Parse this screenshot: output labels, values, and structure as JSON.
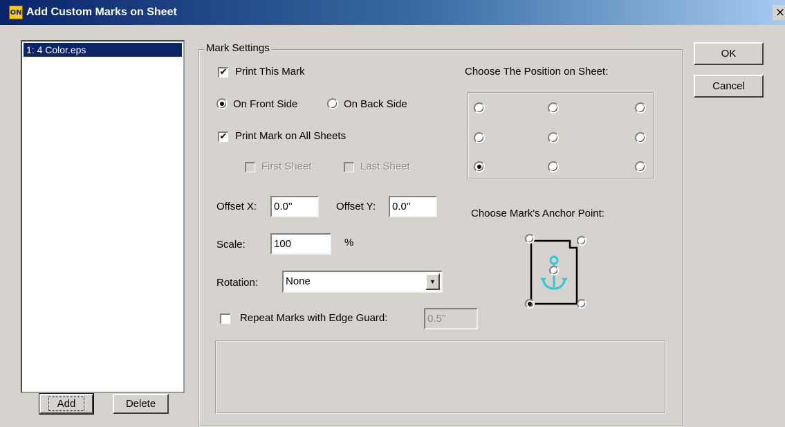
{
  "window": {
    "title": "Add Custom Marks on Sheet",
    "icon_label": "ON",
    "close_label": "×"
  },
  "marks_list": {
    "items": [
      "1: 4 Color.eps"
    ]
  },
  "buttons": {
    "add": "Add",
    "delete": "Delete",
    "ok": "OK",
    "cancel": "Cancel"
  },
  "mark_settings": {
    "legend": "Mark Settings",
    "print_this_mark": {
      "label": "Print This Mark",
      "checked": true,
      "check_glyph": "✔"
    },
    "front_side": {
      "label": "On Front Side",
      "checked": true
    },
    "back_side": {
      "label": "On Back Side",
      "checked": false
    },
    "print_all_sheets": {
      "label": "Print Mark on All Sheets",
      "checked": true,
      "check_glyph": "✔"
    },
    "first_sheet": {
      "label": "First Sheet",
      "checked": false,
      "enabled": false
    },
    "last_sheet": {
      "label": "Last Sheet",
      "checked": false,
      "enabled": false
    },
    "offset_x": {
      "label": "Offset X:",
      "value": "0.0''"
    },
    "offset_y": {
      "label": "Offset Y:",
      "value": "0.0''"
    },
    "scale": {
      "label": "Scale:",
      "value": "100",
      "unit": "%"
    },
    "rotation": {
      "label": "Rotation:",
      "value": "None",
      "arrow": "▼"
    },
    "edge_guard": {
      "label": "Repeat Marks with Edge Guard:",
      "checked": false,
      "value": "0.5''"
    }
  },
  "position": {
    "label": "Choose The Position on Sheet:",
    "selected": "bottom-left"
  },
  "anchor": {
    "label": "Choose Mark's Anchor Point:",
    "selected": "bottom-left",
    "colors": {
      "anchor_icon": "#33c8d8"
    }
  }
}
